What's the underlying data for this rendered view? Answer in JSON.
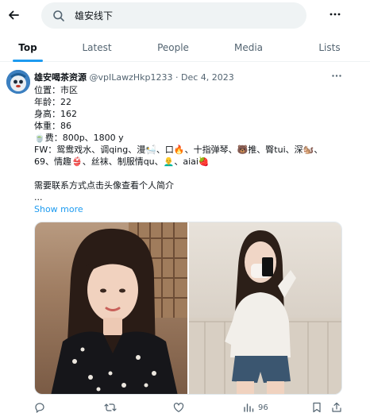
{
  "search": {
    "query": "雄安线下"
  },
  "tabs": [
    {
      "label": "Top",
      "active": true
    },
    {
      "label": "Latest"
    },
    {
      "label": "People"
    },
    {
      "label": "Media"
    },
    {
      "label": "Lists"
    }
  ],
  "tweet": {
    "author_name": "雄安喝茶资源",
    "author_meta": "@vpILawzHkp1233 · Dec 4, 2023",
    "lines": [
      "位置：市区",
      "年龄：22",
      "身高：162",
      "体重：86",
      "🍵费：800p、1800 y",
      "FW：鸳鸯戏水、调qing、漫🛀、口🔥、十指弹琴、🐻推、臀tui、深🐿️、",
      "69、情趣👙、丝袜、制服情qu、👨‍🦲、aiai🍓"
    ],
    "contact_line": "需要联系方式点击头像查看个人简介",
    "ellipsis": "...",
    "show_more": "Show more"
  },
  "actions": {
    "views": "96"
  },
  "colors": {
    "accent": "#1d9bf0",
    "text": "#0f1419",
    "secondary": "#536471",
    "search_bg": "#eff3f4"
  },
  "icons": [
    "back-arrow-icon",
    "search-icon",
    "more-icon",
    "reply-icon",
    "retweet-icon",
    "like-icon",
    "views-icon",
    "bookmark-icon",
    "share-icon"
  ]
}
